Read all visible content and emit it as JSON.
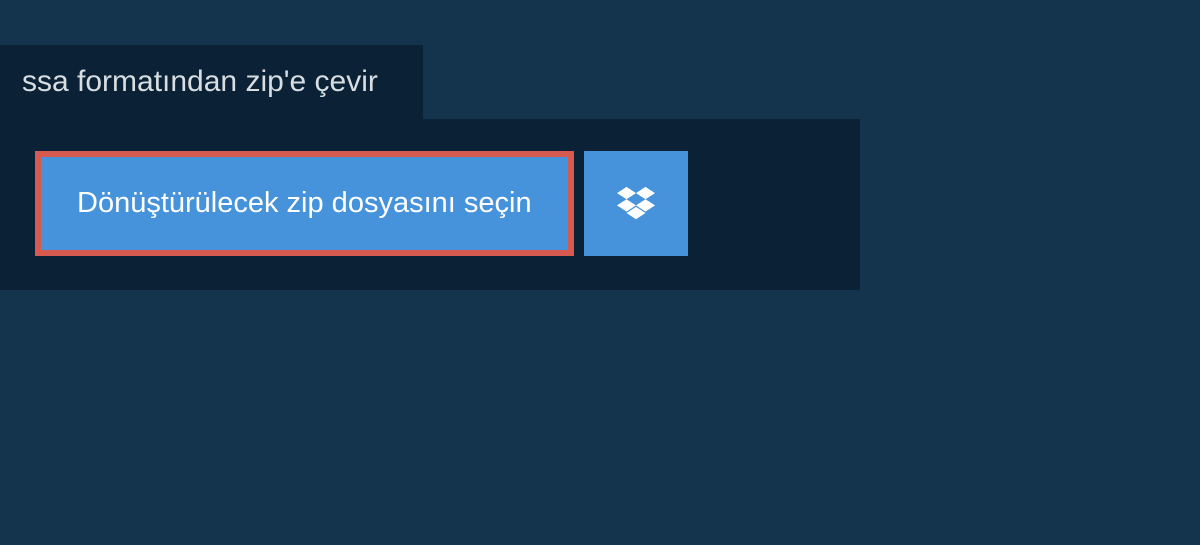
{
  "tab": {
    "title": "ssa formatından zip'e çevir"
  },
  "actions": {
    "select_file_label": "Dönüştürülecek zip dosyasını seçin"
  }
}
